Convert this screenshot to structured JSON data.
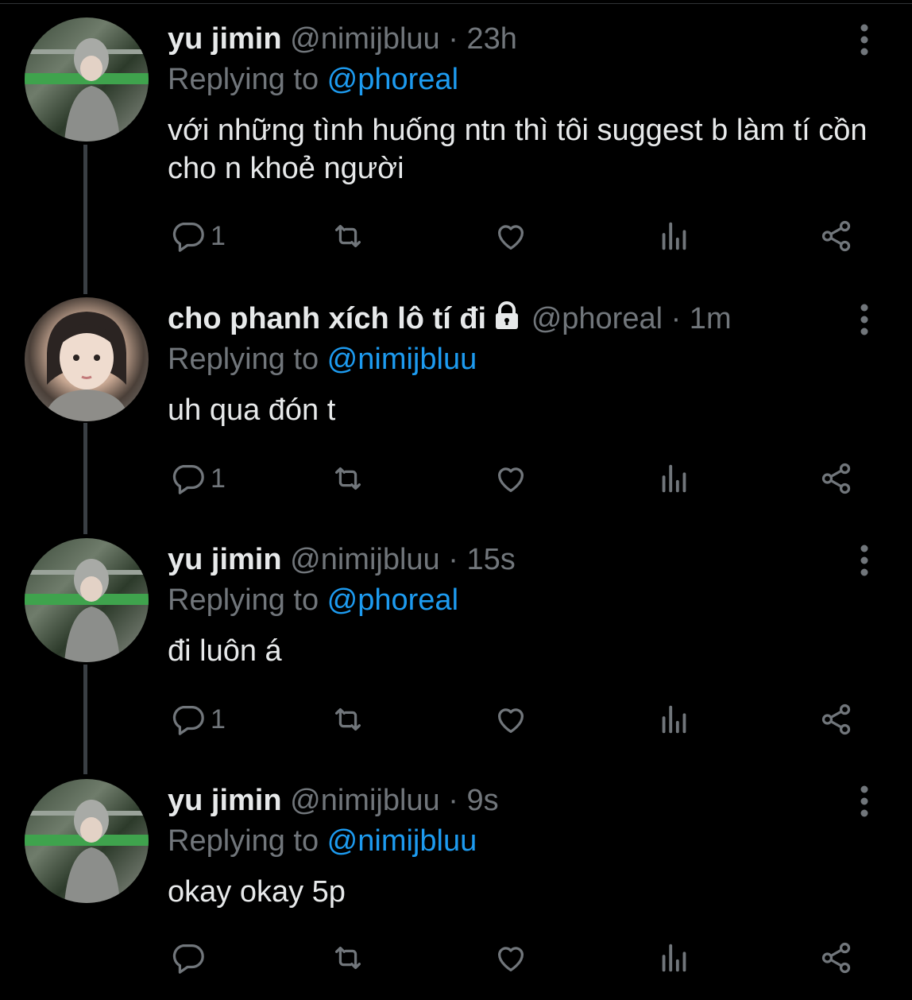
{
  "tweets": [
    {
      "name": "yu jimin",
      "handle": "@nimijbluu",
      "time": "· 23h",
      "replying_label": "Replying to ",
      "replying_to": "@phoreal",
      "text": "với những tình huống ntn thì tôi suggest b làm tí cồn cho n khoẻ người",
      "reply_count": "1",
      "avatar": "avatar-yu-jimin",
      "locked": false
    },
    {
      "name": "cho phanh xích lô tí đi",
      "handle": "@phoreal",
      "time": "· 1m",
      "replying_label": "Replying to ",
      "replying_to": "@nimijbluu",
      "text": "uh qua đón t",
      "reply_count": "1",
      "avatar": "avatar-cho-phanh",
      "locked": true
    },
    {
      "name": "yu jimin",
      "handle": "@nimijbluu",
      "time": "· 15s",
      "replying_label": "Replying to ",
      "replying_to": "@phoreal",
      "text": "đi luôn á",
      "reply_count": "1",
      "avatar": "avatar-yu-jimin",
      "locked": false
    },
    {
      "name": "yu jimin",
      "handle": "@nimijbluu",
      "time": "· 9s",
      "replying_label": "Replying to ",
      "replying_to": "@nimijbluu",
      "text": "okay okay 5p",
      "reply_count": "",
      "avatar": "avatar-yu-jimin",
      "locked": false
    }
  ],
  "icons": {
    "reply": "reply-icon",
    "retweet": "retweet-icon",
    "like": "like-icon",
    "views": "views-icon",
    "share": "share-icon",
    "more": "more-vertical-icon",
    "lock": "lock-icon"
  },
  "colors": {
    "background": "#000000",
    "text": "#e7e9ea",
    "muted": "#71767b",
    "link": "#1d9bf0",
    "thread_line": "#3a3f44"
  }
}
